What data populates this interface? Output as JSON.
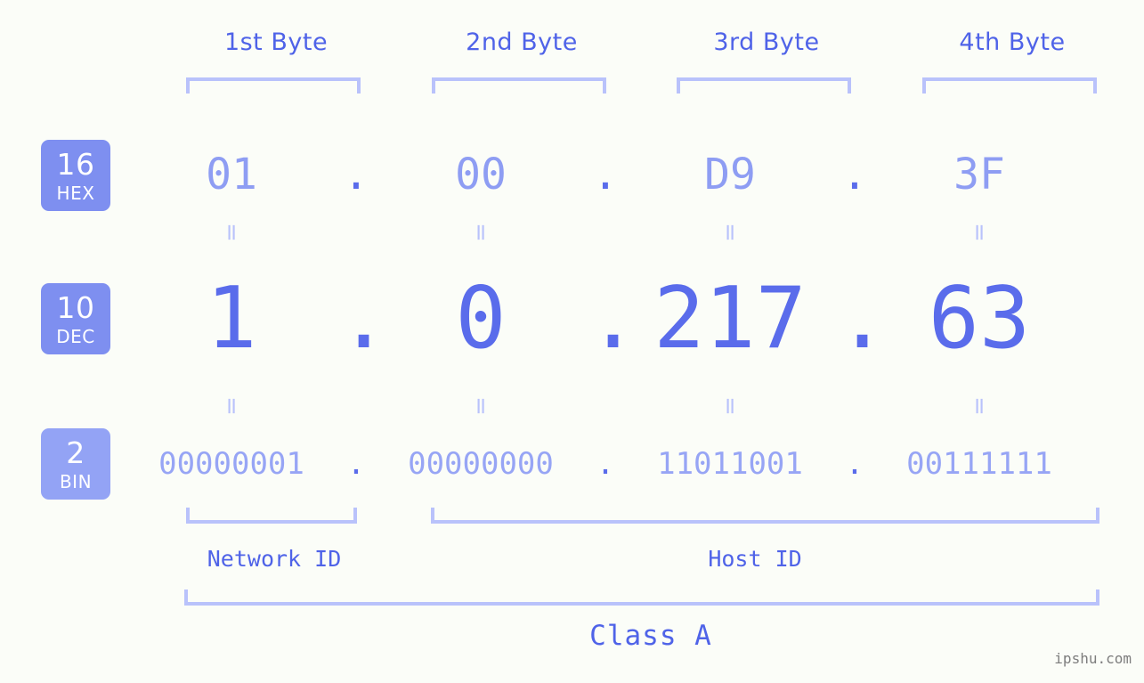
{
  "page": {
    "background": "#fbfdf8",
    "accent": "#5a6ceb",
    "accent_light": "#b9c2fb",
    "watermark": "ipshu.com"
  },
  "headers": [
    {
      "label": "1st Byte"
    },
    {
      "label": "2nd Byte"
    },
    {
      "label": "3rd Byte"
    },
    {
      "label": "4th Byte"
    }
  ],
  "bases": [
    {
      "num": "16",
      "name": "HEX",
      "color": "#7e8ff0"
    },
    {
      "num": "10",
      "name": "DEC",
      "color": "#7e8ff0"
    },
    {
      "num": "2",
      "name": "BIN",
      "color": "#93a3f5"
    }
  ],
  "rows": {
    "hex": {
      "base": "16",
      "label": "HEX",
      "separator": ".",
      "values": [
        "01",
        "00",
        "D9",
        "3F"
      ]
    },
    "dec": {
      "base": "10",
      "label": "DEC",
      "separator": ".",
      "values": [
        "1",
        "0",
        "217",
        "63"
      ]
    },
    "bin": {
      "base": "2",
      "label": "BIN",
      "separator": ".",
      "values": [
        "00000001",
        "00000000",
        "11011001",
        "00111111"
      ]
    }
  },
  "equals_mark": "=",
  "sections": {
    "network_id": "Network ID",
    "host_id": "Host ID",
    "class": "Class A"
  }
}
